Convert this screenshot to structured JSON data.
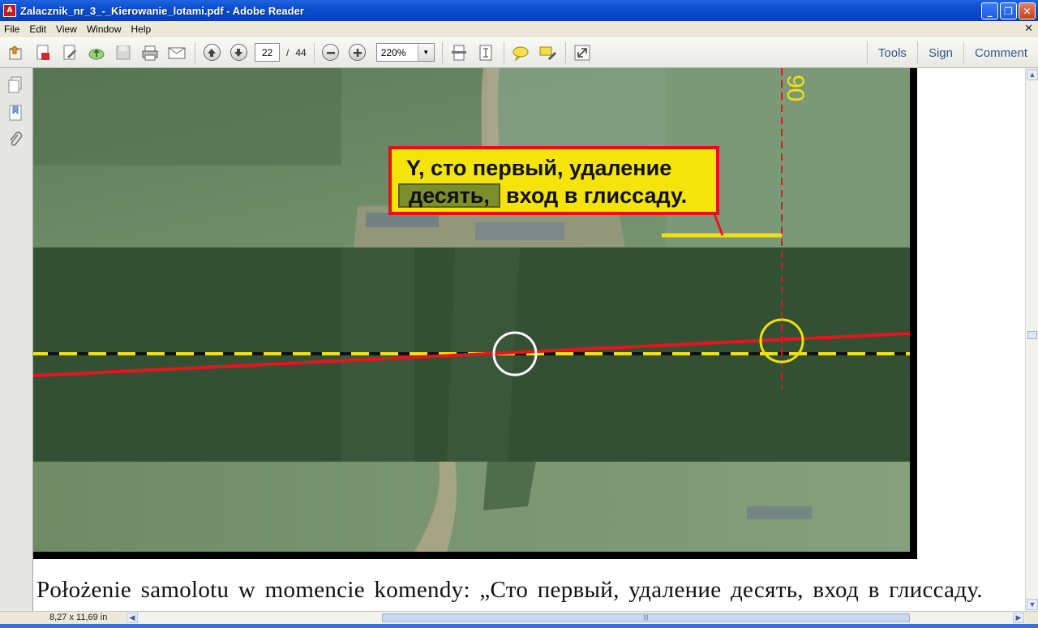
{
  "window": {
    "title": "Zalacznik_nr_3_-_Kierowanie_lotami.pdf - Adobe Reader",
    "app_icon_text": "A",
    "minimize": "_",
    "restore": "❐",
    "close": "✕"
  },
  "menu": {
    "items": [
      "File",
      "Edit",
      "View",
      "Window",
      "Help"
    ],
    "close_doc": "✕"
  },
  "toolbar": {
    "current_page": "22",
    "page_separator": "/",
    "total_pages": "44",
    "zoom": "220%",
    "tools_label": "Tools",
    "sign_label": "Sign",
    "comment_label": "Comment"
  },
  "document": {
    "callout_line1": "Y,  сто первый,  удаление",
    "callout_highlight": "десять,",
    "callout_rest": "вход в глиссаду.",
    "runway_marker": "90",
    "caption": "Położenie samolotu w momencie komendy: „Сто первый, удаление десять, вход в глиссаду."
  },
  "status": {
    "page_size": "8,27 x 11,69 in"
  },
  "colors": {
    "titlebar": "#0a4fd0",
    "callout_fill": "#f5e30c",
    "callout_border": "#e3101a",
    "glide_line": "#e8141c",
    "centerline_yellow": "#f0e010",
    "highlight": "#7b8f2c"
  }
}
